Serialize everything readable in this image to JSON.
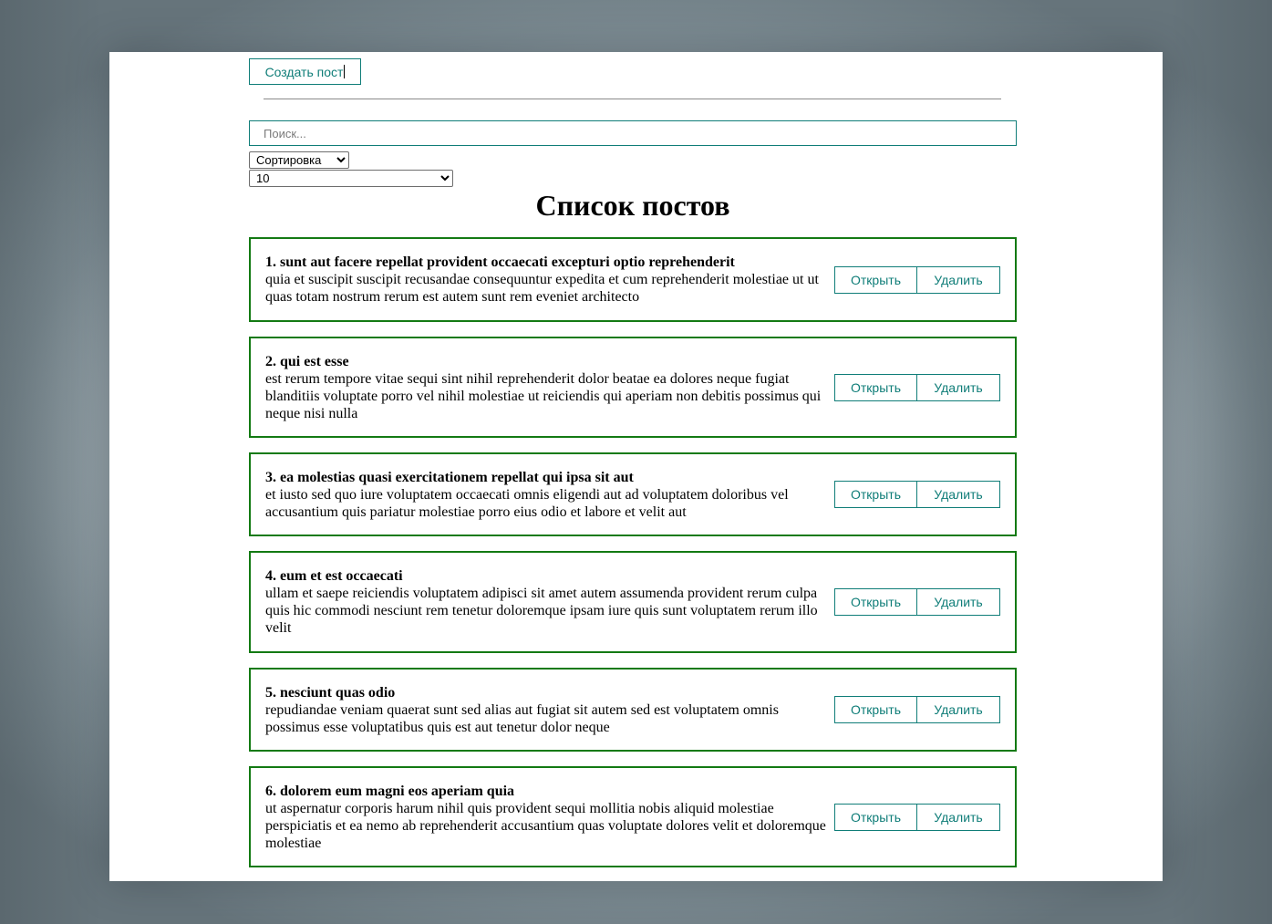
{
  "toolbar": {
    "create_label": "Создать пост"
  },
  "search": {
    "placeholder": "Поиск...",
    "value": ""
  },
  "sort": {
    "selected": "Сортировка"
  },
  "limit": {
    "selected": "10"
  },
  "list": {
    "title": "Список постов"
  },
  "posts": [
    {
      "title": "1. sunt aut facere repellat provident occaecati excepturi optio reprehenderit",
      "body": "quia et suscipit suscipit recusandae consequuntur expedita et cum reprehenderit molestiae ut ut quas totam nostrum rerum est autem sunt rem eveniet architecto",
      "open_label": "Открыть",
      "delete_label": "Удалить"
    },
    {
      "title": "2. qui est esse",
      "body": "est rerum tempore vitae sequi sint nihil reprehenderit dolor beatae ea dolores neque fugiat blanditiis voluptate porro vel nihil molestiae ut reiciendis qui aperiam non debitis possimus qui neque nisi nulla",
      "open_label": "Открыть",
      "delete_label": "Удалить"
    },
    {
      "title": "3. ea molestias quasi exercitationem repellat qui ipsa sit aut",
      "body": "et iusto sed quo iure voluptatem occaecati omnis eligendi aut ad voluptatem doloribus vel accusantium quis pariatur molestiae porro eius odio et labore et velit aut",
      "open_label": "Открыть",
      "delete_label": "Удалить"
    },
    {
      "title": "4. eum et est occaecati",
      "body": "ullam et saepe reiciendis voluptatem adipisci sit amet autem assumenda provident rerum culpa quis hic commodi nesciunt rem tenetur doloremque ipsam iure quis sunt voluptatem rerum illo velit",
      "open_label": "Открыть",
      "delete_label": "Удалить"
    },
    {
      "title": "5. nesciunt quas odio",
      "body": "repudiandae veniam quaerat sunt sed alias aut fugiat sit autem sed est voluptatem omnis possimus esse voluptatibus quis est aut tenetur dolor neque",
      "open_label": "Открыть",
      "delete_label": "Удалить"
    },
    {
      "title": "6. dolorem eum magni eos aperiam quia",
      "body": "ut aspernatur corporis harum nihil quis provident sequi mollitia nobis aliquid molestiae perspiciatis et ea nemo ab reprehenderit accusantium quas voluptate dolores velit et doloremque molestiae",
      "open_label": "Открыть",
      "delete_label": "Удалить"
    }
  ],
  "colors": {
    "accent": "#0f7d78",
    "post_border": "#137a13"
  }
}
